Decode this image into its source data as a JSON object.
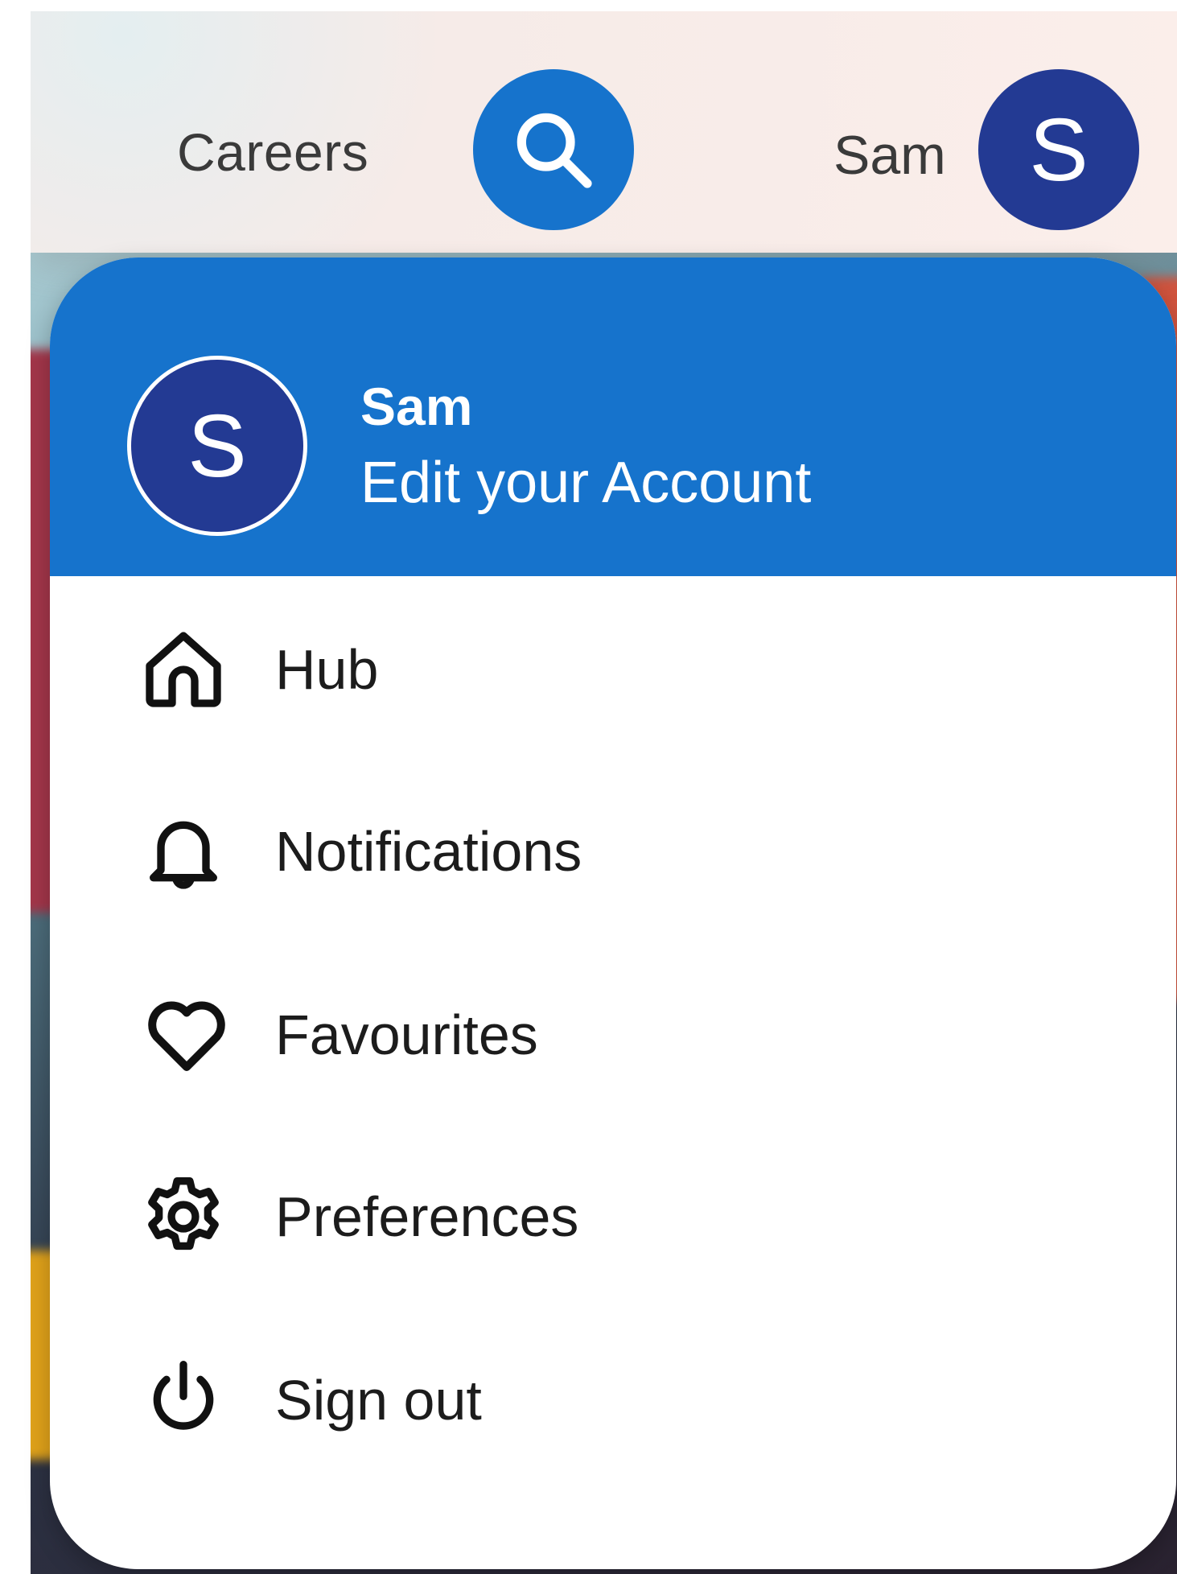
{
  "header": {
    "nav_careers": "Careers",
    "username": "Sam",
    "avatar_initial": "S"
  },
  "account_menu": {
    "avatar_initial": "S",
    "user_name": "Sam",
    "edit_account_label": "Edit your Account",
    "items": [
      {
        "label": "Hub",
        "icon": "home-icon"
      },
      {
        "label": "Notifications",
        "icon": "bell-icon"
      },
      {
        "label": "Favourites",
        "icon": "heart-icon"
      },
      {
        "label": "Preferences",
        "icon": "gear-icon"
      },
      {
        "label": "Sign out",
        "icon": "power-icon"
      }
    ]
  },
  "colors": {
    "primary_blue": "#1673cc",
    "avatar_navy": "#233a93",
    "header_bg": "#fbeeea",
    "menu_text": "#1c1c1c"
  }
}
